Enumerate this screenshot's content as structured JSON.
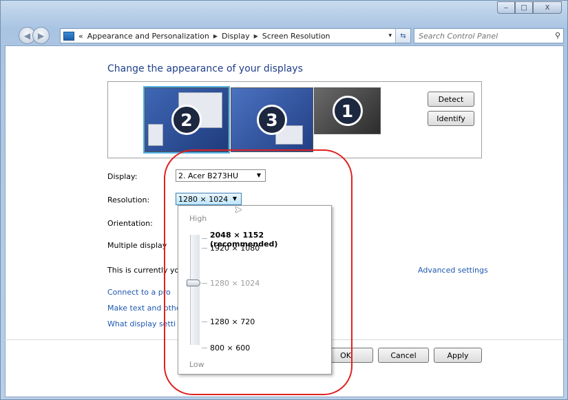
{
  "window": {
    "controls": {
      "minimize": "‒",
      "maximize": "□",
      "close": "X"
    }
  },
  "address_bar": {
    "prefix": "«",
    "crumbs": [
      "Appearance and Personalization",
      "Display",
      "Screen Resolution"
    ],
    "separator": "▶",
    "dropdown": "▾",
    "refresh": "⇆"
  },
  "search": {
    "placeholder": "Search Control Panel",
    "icon": "search-icon"
  },
  "page": {
    "title": "Change the appearance of your displays",
    "monitors": [
      {
        "number": "2",
        "selected": true
      },
      {
        "number": "3",
        "selected": false
      },
      {
        "number": "1",
        "selected": false
      }
    ],
    "detect_label": "Detect",
    "identify_label": "Identify"
  },
  "settings": {
    "display_label": "Display:",
    "display_value": "2. Acer B273HU",
    "resolution_label": "Resolution:",
    "resolution_value": "1280 × 1024",
    "orientation_label": "Orientation:",
    "multiple_label": "Multiple display",
    "current_text": "This is currently you",
    "advanced_link": "Advanced settings",
    "links": [
      "Connect to a pro",
      "Make text and othe",
      "What display setti"
    ]
  },
  "resolution_dropdown": {
    "high_label": "High",
    "low_label": "Low",
    "options": [
      {
        "label": "2048 × 1152 (recommended)",
        "style": "recommended"
      },
      {
        "label": "1920 × 1080",
        "style": "normal"
      },
      {
        "label": "1280 × 1024",
        "style": "current"
      },
      {
        "label": "1280 × 720",
        "style": "normal"
      },
      {
        "label": "800 × 600",
        "style": "normal"
      }
    ]
  },
  "footer": {
    "ok_label": "OK",
    "cancel_label": "Cancel",
    "apply_label": "Apply"
  },
  "colors": {
    "title_blue": "#1e3d8a",
    "link_blue": "#1e57b0",
    "annotation_red": "#e02020",
    "selection_outline": "#4fb3ea"
  }
}
